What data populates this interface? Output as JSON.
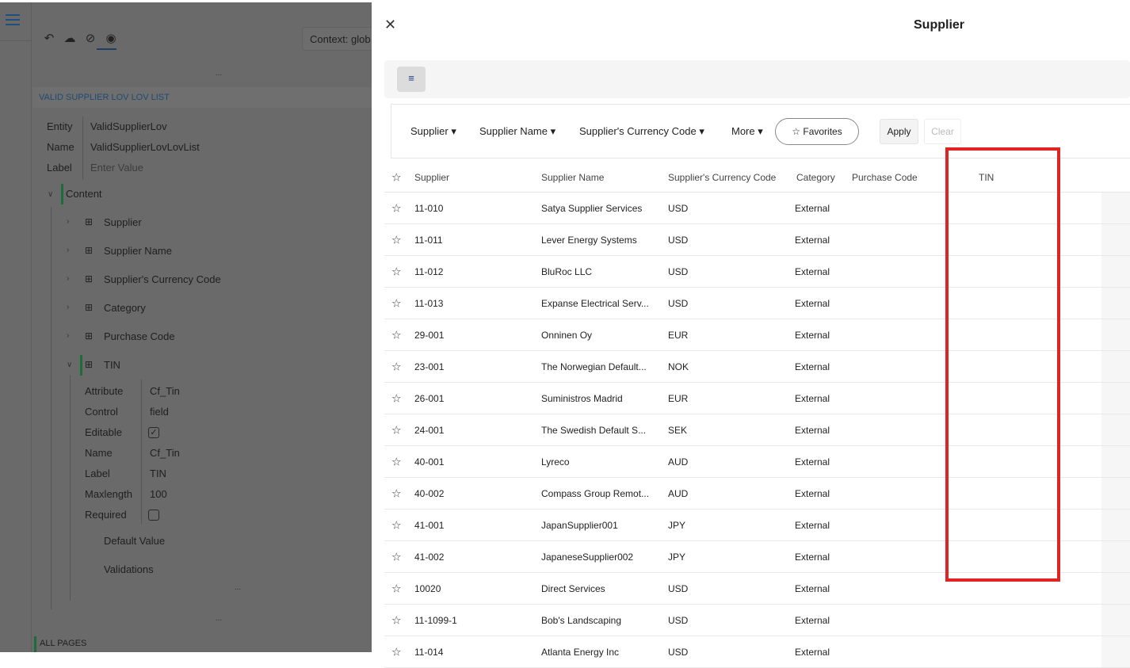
{
  "left": {
    "context_label": "Context: glob",
    "section_title": "VALID SUPPLIER LOV LOV LIST",
    "props": [
      {
        "k": "Entity",
        "v": "ValidSupplierLov"
      },
      {
        "k": "Name",
        "v": "ValidSupplierLovLovList"
      },
      {
        "k": "Label",
        "v": "Enter Value"
      }
    ],
    "content_label": "Content",
    "tree": [
      "Supplier",
      "Supplier Name",
      "Supplier's Currency Code",
      "Category",
      "Purchase Code",
      "TIN"
    ],
    "tin_props": [
      {
        "k": "Attribute",
        "v": "Cf_Tin"
      },
      {
        "k": "Control",
        "v": "field"
      },
      {
        "k": "Editable",
        "v": ""
      },
      {
        "k": "Name",
        "v": "Cf_Tin"
      },
      {
        "k": "Label",
        "v": "TIN"
      },
      {
        "k": "Maxlength",
        "v": "100"
      },
      {
        "k": "Required",
        "v": ""
      }
    ],
    "editable_checked": true,
    "required_checked": false,
    "default_value": "Default Value",
    "validations": "Validations",
    "ellipsis": "...",
    "all_pages": "ALL PAGES"
  },
  "drawer": {
    "title": "Supplier",
    "filters": [
      "Supplier",
      "Supplier Name",
      "Supplier's Currency Code",
      "More"
    ],
    "favorites": "Favorites",
    "apply": "Apply",
    "clear": "Clear",
    "columns": [
      "Supplier",
      "Supplier Name",
      "Supplier's Currency Code",
      "Category",
      "Purchase Code",
      "TIN"
    ],
    "rows": [
      [
        "11-010",
        "Satya Supplier Services",
        "USD",
        "External"
      ],
      [
        "11-011",
        "Lever Energy Systems",
        "USD",
        "External"
      ],
      [
        "11-012",
        "BluRoc LLC",
        "USD",
        "External"
      ],
      [
        "11-013",
        "Expanse Electrical Serv...",
        "USD",
        "External"
      ],
      [
        "29-001",
        "Onninen Oy",
        "EUR",
        "External"
      ],
      [
        "23-001",
        "The Norwegian Default...",
        "NOK",
        "External"
      ],
      [
        "26-001",
        "Suministros Madrid",
        "EUR",
        "External"
      ],
      [
        "24-001",
        "The Swedish Default S...",
        "SEK",
        "External"
      ],
      [
        "40-001",
        "Lyreco",
        "AUD",
        "External"
      ],
      [
        "40-002",
        "Compass Group Remot...",
        "AUD",
        "External"
      ],
      [
        "41-001",
        "JapanSupplier001",
        "JPY",
        "External"
      ],
      [
        "41-002",
        "JapaneseSupplier002",
        "JPY",
        "External"
      ],
      [
        "10020",
        "Direct Services",
        "USD",
        "External"
      ],
      [
        "11-1099-1",
        "Bob's Landscaping",
        "USD",
        "External"
      ],
      [
        "11-014",
        "Atlanta Energy Inc",
        "USD",
        "External"
      ]
    ]
  },
  "colors": {
    "highlight": "#e02424",
    "accent": "#1e6b3a"
  }
}
